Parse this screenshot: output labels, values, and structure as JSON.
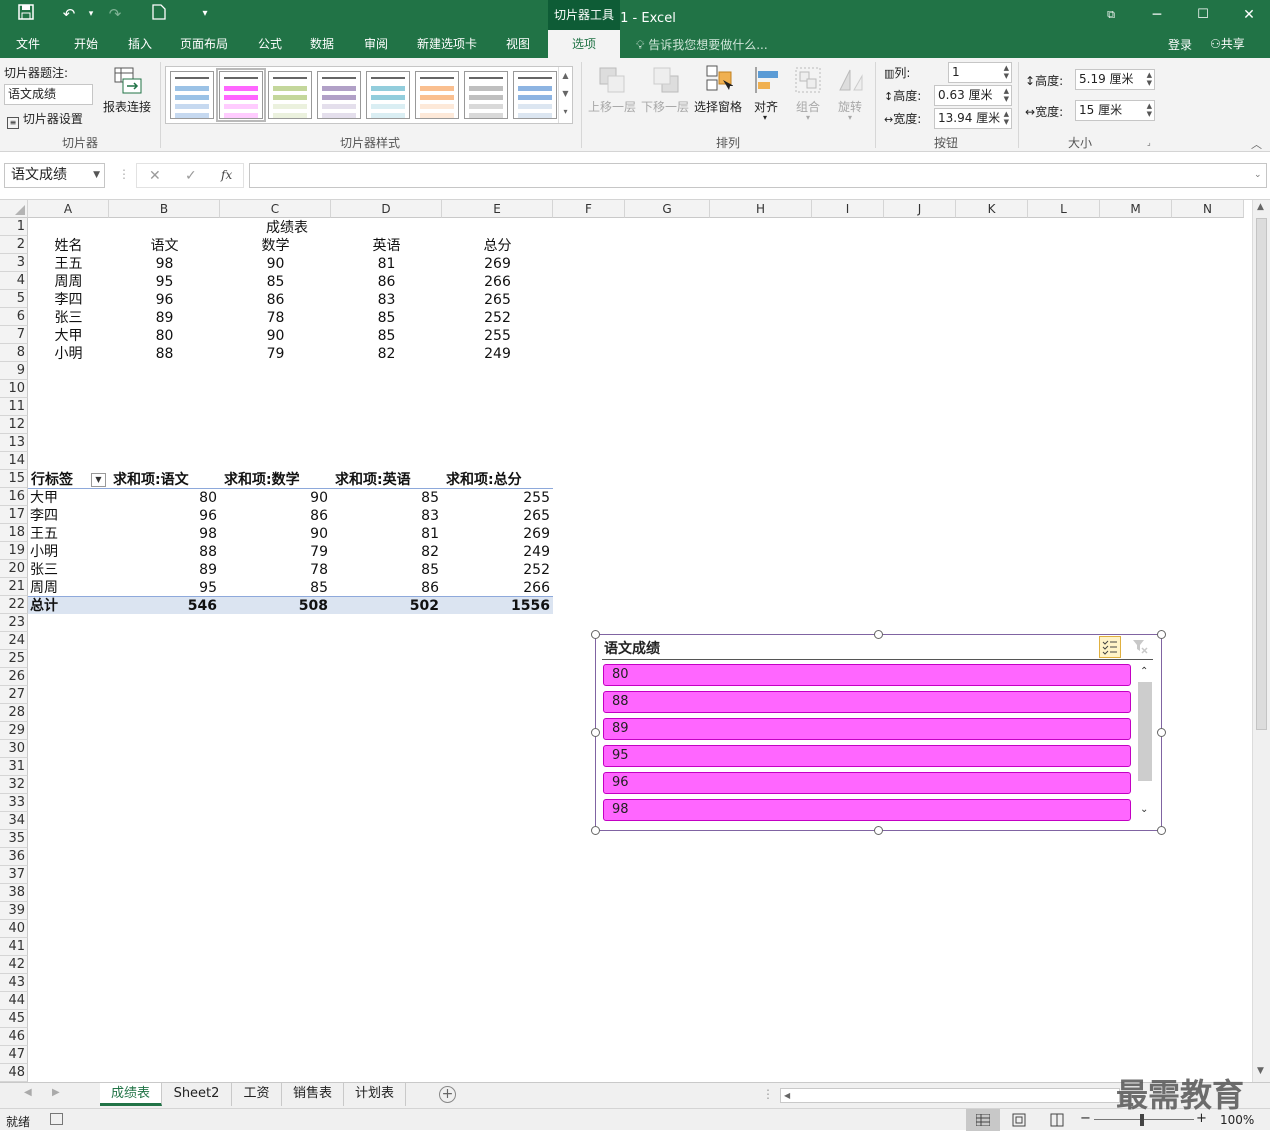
{
  "window": {
    "title": "表格1 - Excel",
    "context_tool": "切片器工具",
    "restore_icon": "restore-icon",
    "minimize": "─",
    "maximize": "☐",
    "close": "✕"
  },
  "quick_access": {
    "save_icon": "save-icon",
    "undo_icon": "undo-icon",
    "redo_icon": "redo-icon",
    "new_icon": "new-file-icon",
    "customize_icon": "customize-icon"
  },
  "tabs": [
    "文件",
    "开始",
    "插入",
    "页面布局",
    "公式",
    "数据",
    "审阅",
    "新建选项卡",
    "视图",
    "选项"
  ],
  "active_tab": "选项",
  "tell_me": "告诉我您想要做什么...",
  "account": {
    "login": "登录",
    "share": "共享"
  },
  "ribbon": {
    "slicer_group": {
      "caption_label": "切片器题注:",
      "caption_value": "语文成绩",
      "settings": "切片器设置",
      "report_connections": "报表连接",
      "label": "切片器"
    },
    "styles_group": {
      "label": "切片器样式"
    },
    "arrange_group": {
      "bring_forward": "上移一层",
      "send_backward": "下移一层",
      "selection_pane": "选择窗格",
      "align": "对齐",
      "group": "组合",
      "rotate": "旋转",
      "label": "排列"
    },
    "buttons_group": {
      "columns_label": "列:",
      "columns_value": "1",
      "height_label": "高度:",
      "height_value": "0.63 厘米",
      "width_label": "宽度:",
      "width_value": "13.94 厘米",
      "label": "按钮"
    },
    "size_group": {
      "height_label": "高度:",
      "height_value": "5.19 厘米",
      "width_label": "宽度:",
      "width_value": "15 厘米",
      "label": "大小"
    }
  },
  "formula_bar": {
    "name_box": "语文成绩",
    "cancel": "✕",
    "enter": "✓",
    "fx": "fx",
    "formula": ""
  },
  "columns": [
    "A",
    "B",
    "C",
    "D",
    "E",
    "F",
    "G",
    "H",
    "I",
    "J",
    "K",
    "L",
    "M",
    "N"
  ],
  "rows": [
    "1",
    "2",
    "3",
    "4",
    "5",
    "6",
    "7",
    "8",
    "9",
    "10",
    "11",
    "12",
    "13",
    "14",
    "15",
    "16",
    "17",
    "18",
    "19",
    "20",
    "21",
    "22",
    "23",
    "24",
    "25",
    "26",
    "27",
    "28",
    "29",
    "30",
    "31",
    "32",
    "33",
    "34",
    "35",
    "36",
    "37",
    "38",
    "39",
    "40",
    "41",
    "42",
    "43",
    "44",
    "45",
    "46",
    "47",
    "48"
  ],
  "table": {
    "title": "成绩表",
    "headers": [
      "姓名",
      "语文",
      "数学",
      "英语",
      "总分"
    ],
    "rows": [
      [
        "王五",
        "98",
        "90",
        "81",
        "269"
      ],
      [
        "周周",
        "95",
        "85",
        "86",
        "266"
      ],
      [
        "李四",
        "96",
        "86",
        "83",
        "265"
      ],
      [
        "张三",
        "89",
        "78",
        "85",
        "252"
      ],
      [
        "大甲",
        "80",
        "90",
        "85",
        "255"
      ],
      [
        "小明",
        "88",
        "79",
        "82",
        "249"
      ]
    ]
  },
  "pivot": {
    "headers": [
      "行标签",
      "求和项:语文",
      "求和项:数学",
      "求和项:英语",
      "求和项:总分"
    ],
    "rows": [
      [
        "大甲",
        "80",
        "90",
        "85",
        "255"
      ],
      [
        "李四",
        "96",
        "86",
        "83",
        "265"
      ],
      [
        "王五",
        "98",
        "90",
        "81",
        "269"
      ],
      [
        "小明",
        "88",
        "79",
        "82",
        "249"
      ],
      [
        "张三",
        "89",
        "78",
        "85",
        "252"
      ],
      [
        "周周",
        "95",
        "85",
        "86",
        "266"
      ]
    ],
    "total": [
      "总计",
      "546",
      "508",
      "502",
      "1556"
    ]
  },
  "slicer": {
    "title": "语文成绩",
    "items": [
      "80",
      "88",
      "89",
      "95",
      "96",
      "98"
    ],
    "item_color": "#ff66ff",
    "multiselect_icon": "multi-select-icon",
    "clear_filter_icon": "clear-filter-icon"
  },
  "sheet_tabs": [
    "成绩表",
    "Sheet2",
    "工资",
    "销售表",
    "计划表"
  ],
  "active_sheet": "成绩表",
  "status": {
    "ready": "就绪",
    "zoom": "100%",
    "minus": "−",
    "plus": "+"
  },
  "watermark": "最需教育",
  "colors": {
    "excel_green": "#217346",
    "slicer_border": "#8064a2",
    "pivot_total_bg": "#dbe4f1"
  }
}
